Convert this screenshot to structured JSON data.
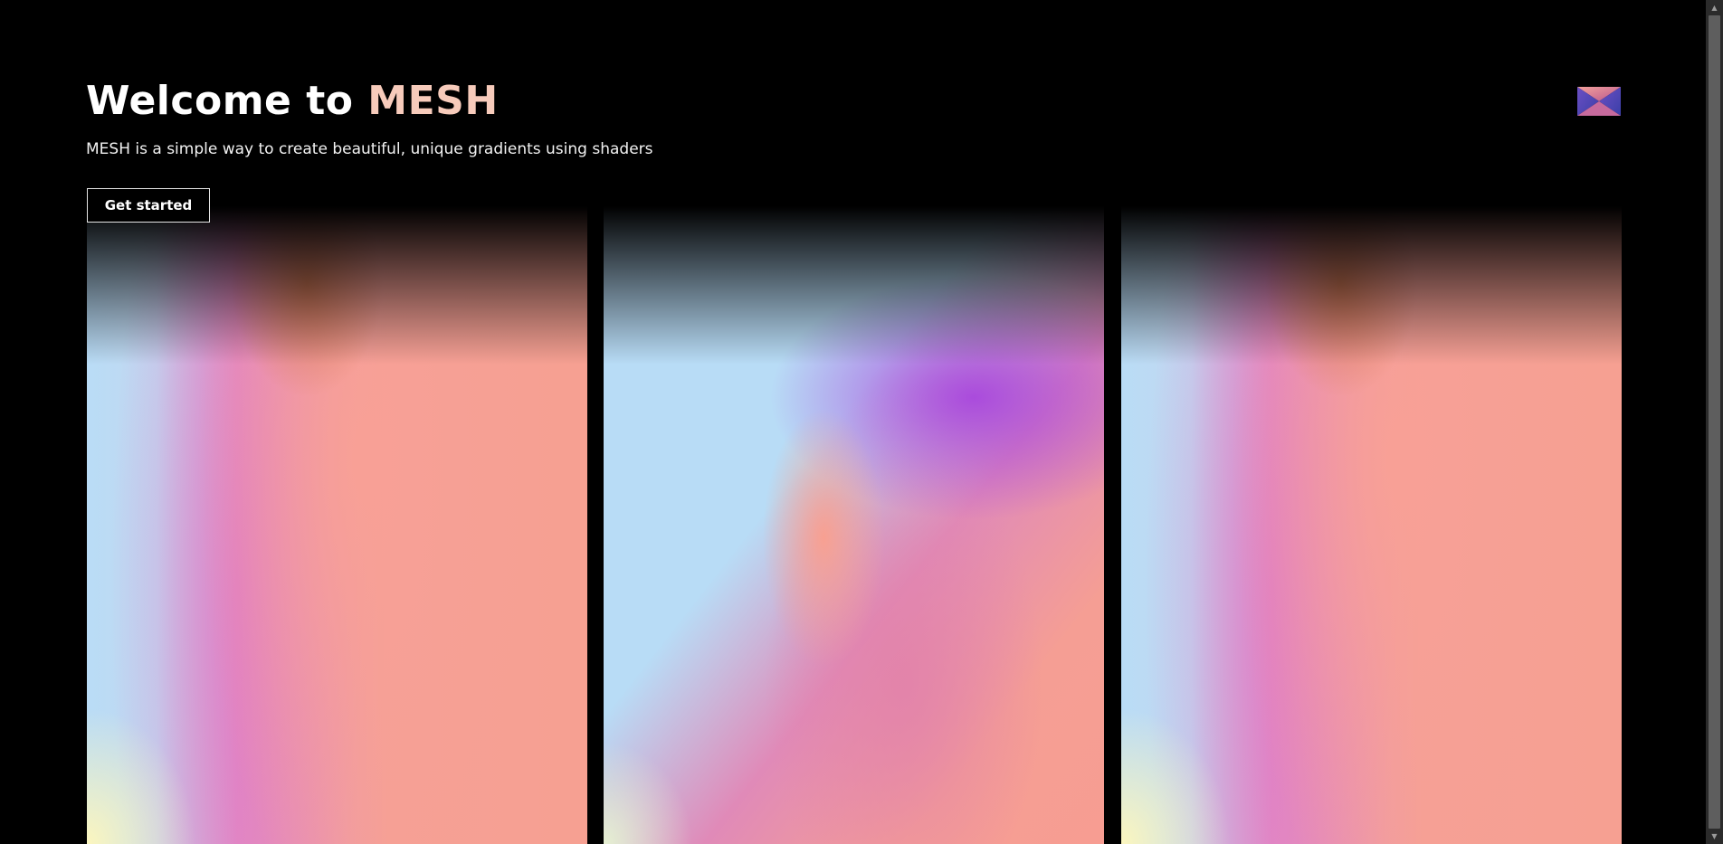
{
  "hero": {
    "title_prefix": "Welcome to ",
    "title_brand": "MESH",
    "subtitle": "MESH is a simple way to create beautiful, unique gradients using shaders",
    "cta_label": "Get started"
  },
  "logo": {
    "icon": "mesh-logo-icon"
  },
  "gradients": [
    "gradient-preview-1",
    "gradient-preview-2",
    "gradient-preview-3"
  ],
  "colors": {
    "background": "#000000",
    "brand_accent": "#f7cbbb",
    "gradient_blue": "#b9dcf6",
    "gradient_pink": "#f6a092",
    "gradient_purple": "#aa4bdc",
    "gradient_cream": "#fcf6be"
  },
  "scrollbar": {
    "up_icon": "▲",
    "down_icon": "▼"
  }
}
